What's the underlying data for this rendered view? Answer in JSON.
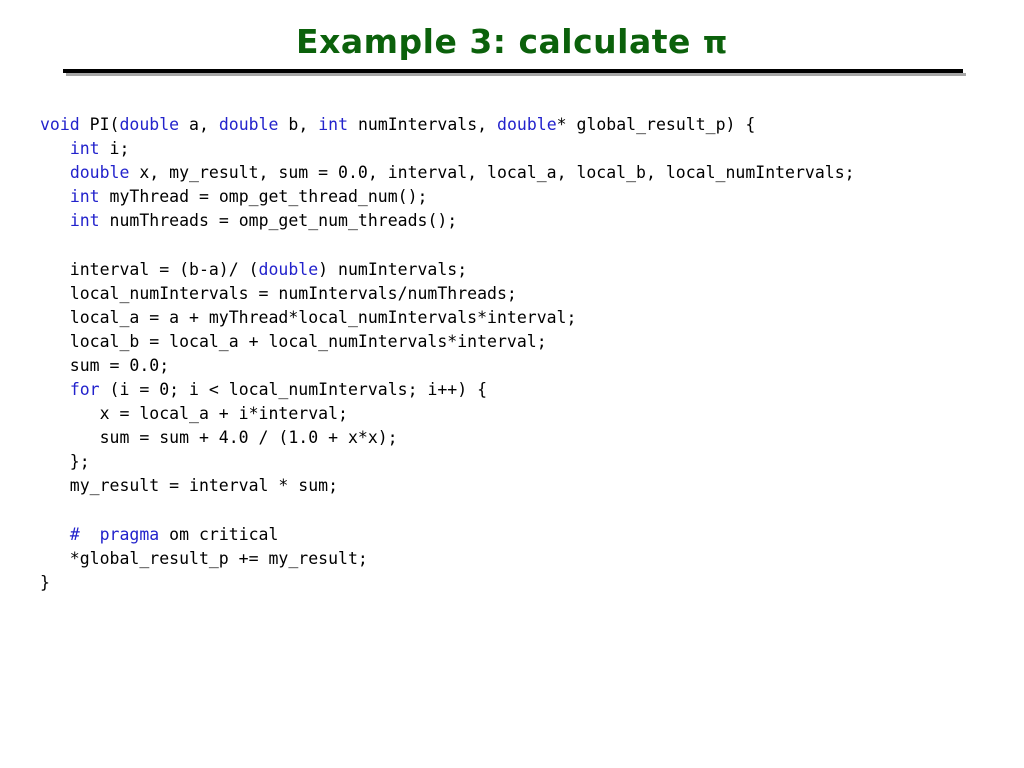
{
  "slide": {
    "title_text": "Example 3: calculate ",
    "title_symbol": "π",
    "title_color": "#0b610b",
    "background_color": "#ffffff",
    "rule_color": "#000000",
    "rule_shadow_color": "#a6a6a6"
  },
  "code": {
    "keyword_color": "#2222cc",
    "text_color": "#000000",
    "language": "C",
    "lines": [
      {
        "id": "line-1",
        "segments": [
          {
            "text": "void ",
            "kind": "keyword"
          },
          {
            "text": "PI(",
            "kind": "plain"
          },
          {
            "text": "double",
            "kind": "keyword"
          },
          {
            "text": " a, ",
            "kind": "plain"
          },
          {
            "text": "double",
            "kind": "keyword"
          },
          {
            "text": " b, ",
            "kind": "plain"
          },
          {
            "text": "int",
            "kind": "keyword"
          },
          {
            "text": " numIntervals, ",
            "kind": "plain"
          },
          {
            "text": "double",
            "kind": "keyword"
          },
          {
            "text": "* global_result_p) {",
            "kind": "plain"
          }
        ]
      },
      {
        "id": "line-2",
        "segments": [
          {
            "text": "   ",
            "kind": "plain"
          },
          {
            "text": "int",
            "kind": "keyword"
          },
          {
            "text": " i;",
            "kind": "plain"
          }
        ]
      },
      {
        "id": "line-3",
        "segments": [
          {
            "text": "   ",
            "kind": "plain"
          },
          {
            "text": "double",
            "kind": "keyword"
          },
          {
            "text": " x, my_result, sum = 0.0, interval, local_a, local_b, local_numIntervals;",
            "kind": "plain"
          }
        ]
      },
      {
        "id": "line-4",
        "segments": [
          {
            "text": "   ",
            "kind": "plain"
          },
          {
            "text": "int",
            "kind": "keyword"
          },
          {
            "text": " myThread = omp_get_thread_num();",
            "kind": "plain"
          }
        ]
      },
      {
        "id": "line-5",
        "segments": [
          {
            "text": "   ",
            "kind": "plain"
          },
          {
            "text": "int",
            "kind": "keyword"
          },
          {
            "text": " numThreads = omp_get_num_threads();",
            "kind": "plain"
          }
        ]
      },
      {
        "id": "line-6",
        "segments": []
      },
      {
        "id": "line-7",
        "segments": [
          {
            "text": "   interval = (b-a)/ (",
            "kind": "plain"
          },
          {
            "text": "double",
            "kind": "keyword"
          },
          {
            "text": ") numIntervals;",
            "kind": "plain"
          }
        ]
      },
      {
        "id": "line-8",
        "segments": [
          {
            "text": "   local_numIntervals = numIntervals/numThreads;",
            "kind": "plain"
          }
        ]
      },
      {
        "id": "line-9",
        "segments": [
          {
            "text": "   local_a = a + myThread*local_numIntervals*interval;",
            "kind": "plain"
          }
        ]
      },
      {
        "id": "line-10",
        "segments": [
          {
            "text": "   local_b = local_a + local_numIntervals*interval;",
            "kind": "plain"
          }
        ]
      },
      {
        "id": "line-11",
        "segments": [
          {
            "text": "   sum = 0.0;",
            "kind": "plain"
          }
        ]
      },
      {
        "id": "line-12",
        "segments": [
          {
            "text": "   ",
            "kind": "plain"
          },
          {
            "text": "for",
            "kind": "keyword"
          },
          {
            "text": " (i = 0; i < local_numIntervals; i++) {",
            "kind": "plain"
          }
        ]
      },
      {
        "id": "line-13",
        "segments": [
          {
            "text": "      x = local_a + i*interval;",
            "kind": "plain"
          }
        ]
      },
      {
        "id": "line-14",
        "segments": [
          {
            "text": "      sum = sum + 4.0 / (1.0 + x*x);",
            "kind": "plain"
          }
        ]
      },
      {
        "id": "line-15",
        "segments": [
          {
            "text": "   };",
            "kind": "plain"
          }
        ]
      },
      {
        "id": "line-16",
        "segments": [
          {
            "text": "   my_result = interval * sum;",
            "kind": "plain"
          }
        ]
      },
      {
        "id": "line-17",
        "segments": []
      },
      {
        "id": "line-18",
        "segments": [
          {
            "text": "   ",
            "kind": "plain"
          },
          {
            "text": "#  pragma",
            "kind": "keyword"
          },
          {
            "text": " om critical",
            "kind": "plain"
          }
        ]
      },
      {
        "id": "line-19",
        "segments": [
          {
            "text": "   *global_result_p += my_result;",
            "kind": "plain"
          }
        ]
      },
      {
        "id": "line-20",
        "segments": [
          {
            "text": "}",
            "kind": "plain"
          }
        ]
      }
    ]
  }
}
